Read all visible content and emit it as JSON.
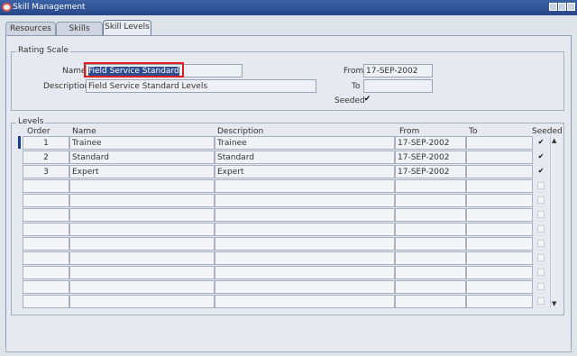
{
  "window": {
    "title": "Skill Management"
  },
  "tabs": [
    {
      "label": "Resources"
    },
    {
      "label": "Skills"
    },
    {
      "label": "Skill Levels"
    }
  ],
  "rating_scale": {
    "legend": "Rating Scale",
    "name_label": "Name",
    "name_value": "Field Service Standard",
    "description_label": "Description",
    "description_value": "Field Service Standard Levels",
    "from_label": "From",
    "from_value": "17-SEP-2002",
    "to_label": "To",
    "to_value": "",
    "seeded_label": "Seeded",
    "seeded_checked": true,
    "seeded_mark": "✔"
  },
  "levels": {
    "legend": "Levels",
    "headers": {
      "order": "Order",
      "name": "Name",
      "description": "Description",
      "from": "From",
      "to": "To",
      "seeded": "Seeded"
    },
    "rows": [
      {
        "order": "1",
        "name": "Trainee",
        "description": "Trainee",
        "from": "17-SEP-2002",
        "to": "",
        "seeded": "✔"
      },
      {
        "order": "2",
        "name": "Standard",
        "description": "Standard",
        "from": "17-SEP-2002",
        "to": "",
        "seeded": "✔"
      },
      {
        "order": "3",
        "name": "Expert",
        "description": "Expert",
        "from": "17-SEP-2002",
        "to": "",
        "seeded": "✔"
      }
    ],
    "empty_rows": 9
  },
  "colors": {
    "titlebar": "#26478a",
    "selection": "#2d4d92",
    "highlight_box": "#e02020",
    "panel": "#e6e9ef"
  }
}
